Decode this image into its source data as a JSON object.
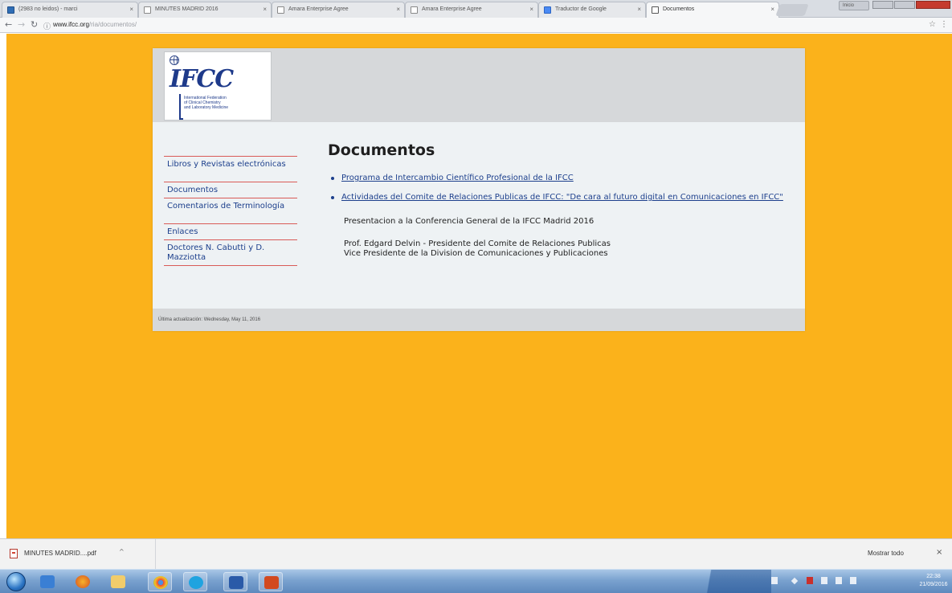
{
  "browser": {
    "tabs": [
      {
        "label": "(2983 no leidos) - marci",
        "favicon": "mail-icon"
      },
      {
        "label": "MINUTES MADRID 2016",
        "favicon": "page-icon"
      },
      {
        "label": "Amara Enterprise Agree",
        "favicon": "page-icon"
      },
      {
        "label": "Amara Enterprise Agree",
        "favicon": "page-icon"
      },
      {
        "label": "Traductor de Google",
        "favicon": "translate-icon"
      },
      {
        "label": "Documentos",
        "favicon": "ifcc-icon",
        "active": true
      }
    ],
    "tab_close": "×",
    "profile": "Inicio",
    "url_host": "www.ifcc.org",
    "url_path": "/ria/documentos/"
  },
  "site": {
    "logo": {
      "mark": "IFCC",
      "lines": [
        "International Federation",
        "of Clinical Chemistry",
        "and Laboratory Medicine"
      ]
    },
    "nav": [
      "Libros y Revistas electrónicas",
      "Documentos",
      "Comentarios de Terminología",
      "Enlaces",
      "Doctores N. Cabutti y D. Mazziotta"
    ],
    "title": "Documentos",
    "links": [
      "Programa de Intercambio Científico Profesional de la IFCC",
      "Actividades del Comite de Relaciones Publicas de IFCC: \"De cara al futuro digital en Comunicaciones en IFCC\""
    ],
    "subtitle": "Presentacion a la Conferencia General de la IFCC Madrid 2016",
    "author_line1": "Prof. Edgard Delvin - Presidente del Comite de Relaciones Publicas",
    "author_line2": "Vice Presidente de la Division de Comunicaciones y Publicaciones",
    "footer": "Última actualización: Wednesday, May 11, 2016"
  },
  "download": {
    "file": "MINUTES MADRID....pdf",
    "chevron": "^",
    "show_all": "Mostrar todo",
    "close": "×"
  },
  "taskbar": {
    "clock_time": "22:38",
    "clock_date": "21/09/2016"
  },
  "colors": {
    "page_bg": "#fbb21b",
    "container_bg": "#eef2f4",
    "link": "#1c3f8c",
    "nav_separator": "#d95b57"
  }
}
